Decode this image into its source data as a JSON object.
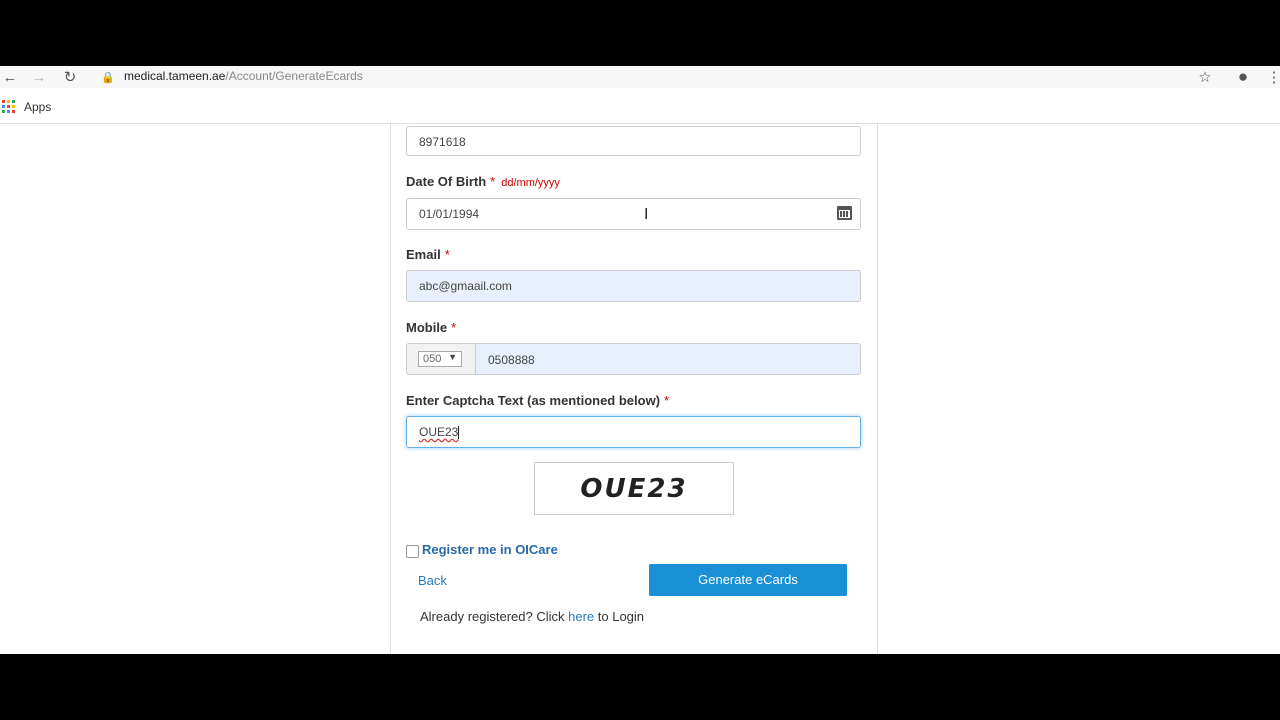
{
  "browser": {
    "url_host": "medical.tameen.ae",
    "url_path": "/Account/GenerateEcards",
    "bookmarks_apps_label": "Apps",
    "apps_colors": [
      "#ea4335",
      "#fbbc05",
      "#34a853",
      "#4285f4",
      "#ea4335",
      "#fbbc05",
      "#34a853",
      "#4285f4",
      "#ea4335"
    ]
  },
  "form": {
    "top_field_value": "8971618",
    "dob": {
      "label": "Date Of Birth",
      "required_mark": "*",
      "hint": "dd/mm/yyyy",
      "value": "01/01/1994"
    },
    "email": {
      "label": "Email",
      "required_mark": "*",
      "value": "abc@gmaail.com"
    },
    "mobile": {
      "label": "Mobile",
      "required_mark": "*",
      "code": "050",
      "value": "0508888"
    },
    "captcha": {
      "label": "Enter Captcha Text (as mentioned below)",
      "required_mark": "*",
      "value": "OUE23",
      "image_text": "OUE23"
    },
    "register_label": "Register me in OICare",
    "back_label": "Back",
    "generate_label": "Generate eCards",
    "login_prefix": "Already registered? Click ",
    "login_link": "here",
    "login_suffix": " to Login"
  }
}
